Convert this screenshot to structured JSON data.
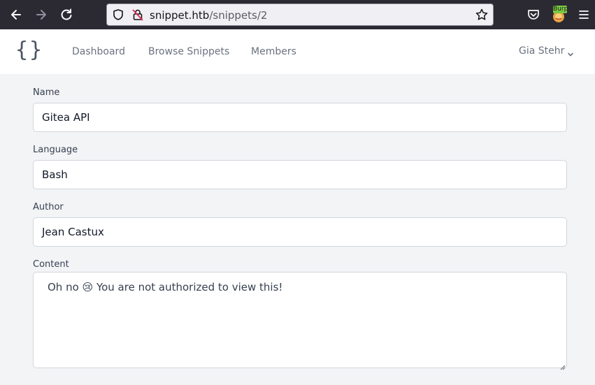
{
  "browser": {
    "url_host": "snippet.htb",
    "url_path": "/snippets/2",
    "extension_badge": "Burp"
  },
  "header": {
    "logo": "{}",
    "nav": {
      "dashboard": "Dashboard",
      "browse_snippets": "Browse Snippets",
      "members": "Members"
    },
    "user_name": "Gia Stehr"
  },
  "form": {
    "name_label": "Name",
    "name_value": "Gitea API",
    "language_label": "Language",
    "language_value": "Bash",
    "author_label": "Author",
    "author_value": "Jean Castux",
    "content_label": "Content",
    "content_value": "Oh no 😢 You are not authorized to view this!"
  },
  "colors": {
    "browser_toolbar": "#2b2a33",
    "page_background": "#f3f4f6",
    "header_background": "#ffffff",
    "nav_text": "#6b7280"
  }
}
